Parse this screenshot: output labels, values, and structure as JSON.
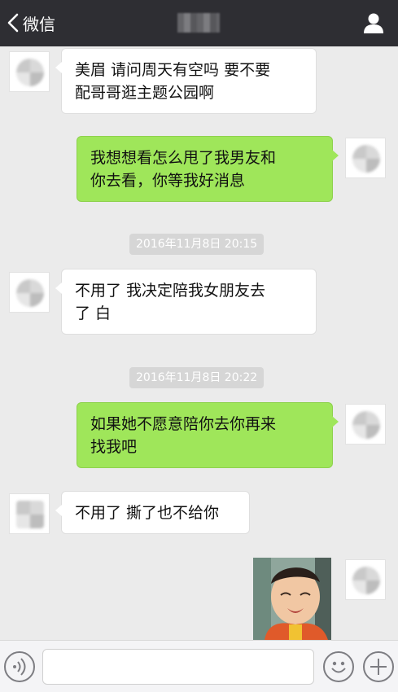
{
  "header": {
    "back_label": "微信",
    "back_icon": "chevron-left-icon",
    "profile_icon": "person-icon",
    "colors": {
      "bar": "#2e2e33",
      "text": "#ffffff"
    }
  },
  "messages": [
    {
      "side": "left",
      "lines": [
        "美眉 请问周天有空吗 要不要",
        "配哥哥逛主题公园啊"
      ]
    },
    {
      "side": "right",
      "lines": [
        "我想想看怎么甩了我男友和",
        "你去看，你等我好消息"
      ]
    },
    {
      "type": "timestamp",
      "text": "2016年11月8日 20:15"
    },
    {
      "side": "left",
      "lines": [
        "不用了 我决定陪我女朋友去",
        "了 白"
      ]
    },
    {
      "type": "timestamp",
      "text": "2016年11月8日 20:22"
    },
    {
      "side": "right",
      "lines": [
        "如果她不愿意陪你去你再来",
        "找我吧"
      ]
    },
    {
      "side": "left",
      "lines": [
        "不用了 撕了也不给你"
      ]
    },
    {
      "side": "right",
      "type": "image",
      "icon": "crying-child-photo"
    }
  ],
  "colors": {
    "background": "#ebebeb",
    "bubble_right": "#9fe65a",
    "bubble_left": "#ffffff"
  },
  "bottombar": {
    "voice_icon": "voice-icon",
    "emoji_icon": "emoji-icon",
    "plus_icon": "plus-icon"
  }
}
